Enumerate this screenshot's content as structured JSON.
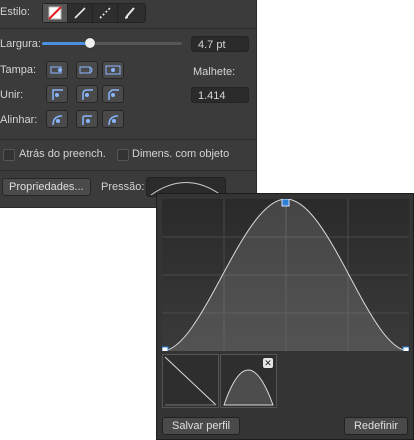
{
  "panel": {
    "style_label": "Estilo:",
    "width_label": "Largura:",
    "width_value": "4.7 pt",
    "width_slider_fraction": 0.34,
    "cap_label": "Tampa:",
    "join_label": "Unir:",
    "align_label": "Alinhar:",
    "mitre_label": "Malhete:",
    "mitre_value": "1.414",
    "behind_fill_label": "Atrás do preench.",
    "scale_with_object_label": "Dimens. com objeto",
    "properties_button": "Propriedades...",
    "pressure_label": "Pressão:",
    "style_icons": [
      "no-stroke-icon",
      "solid-line-icon",
      "dashed-line-icon",
      "brush-icon"
    ],
    "cap_icons": [
      "butt-cap-icon",
      "round-cap-icon",
      "square-cap-icon"
    ],
    "join_icons": [
      "mitre-join-icon",
      "round-join-icon",
      "bevel-join-icon"
    ],
    "align_icons": [
      "align-center-icon",
      "align-inside-icon",
      "align-outside-icon"
    ]
  },
  "pressure_popup": {
    "save_profile_button": "Salvar perfil",
    "reset_button": "Redefinir",
    "presets": [
      "linear-preset-icon",
      "arch-preset-icon"
    ],
    "preset_remove_icon": "close-icon"
  },
  "colors": {
    "accent": "#4a90e2",
    "panel_bg": "#3b3b3b",
    "graph_bg": "#2c2c2c"
  }
}
